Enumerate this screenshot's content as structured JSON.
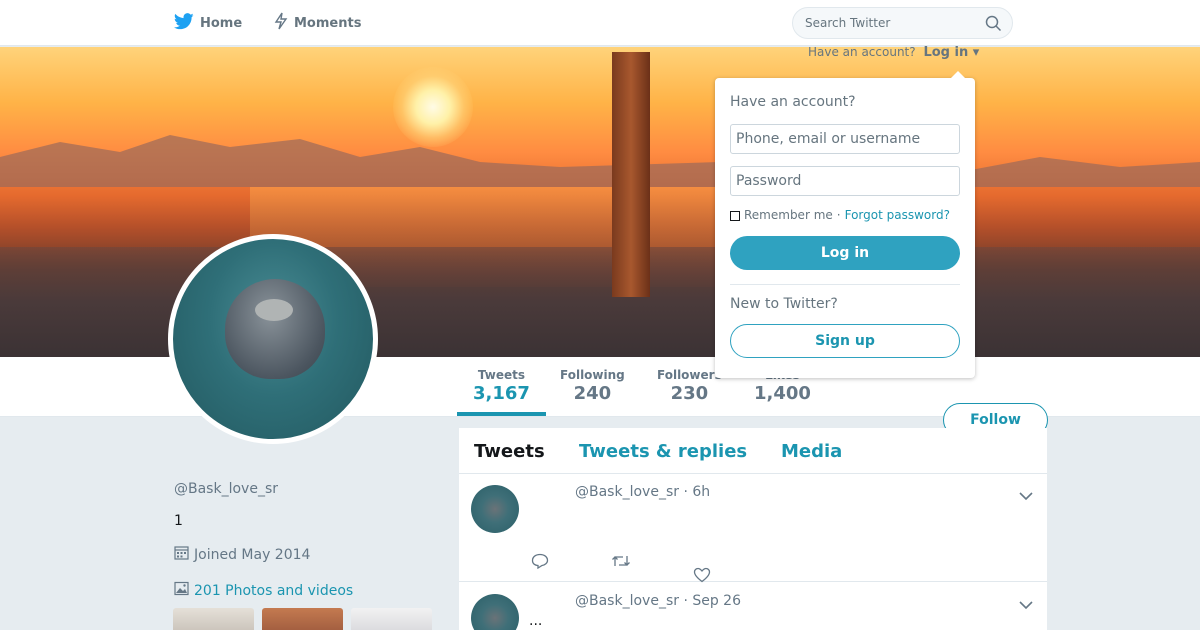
{
  "nav": {
    "home_label": "Home",
    "moments_label": "Moments",
    "search_placeholder": "Search Twitter"
  },
  "login_prompt": {
    "text": "Have an account?",
    "link": "Log in"
  },
  "login_panel": {
    "title": "Have an account?",
    "username_placeholder": "Phone, email or username",
    "password_placeholder": "Password",
    "remember_label": "Remember me",
    "separator": "·",
    "forgot_label": "Forgot password?",
    "login_button": "Log in",
    "new_label": "New to Twitter?",
    "signup_button": "Sign up"
  },
  "stats": [
    {
      "label": "Tweets",
      "value": "3,167"
    },
    {
      "label": "Following",
      "value": "240"
    },
    {
      "label": "Followers",
      "value": "230"
    },
    {
      "label": "Likes",
      "value": "1,400"
    }
  ],
  "follow_button": "Follow",
  "profile": {
    "name": "",
    "handle": "@Bask_love_sr",
    "bio": "1",
    "joined": "Joined May 2014",
    "photos_link": "201 Photos and videos"
  },
  "timeline": {
    "tabs": [
      "Tweets",
      "Tweets & replies",
      "Media"
    ],
    "tweets": [
      {
        "meta": "@Bask_love_sr · 6h",
        "text": ""
      },
      {
        "meta": "@Bask_love_sr · Sep 26",
        "text": "..."
      }
    ]
  },
  "colors": {
    "accent": "#1b95b0",
    "twitter_blue": "#1da1f2",
    "background": "#e6ecf0"
  },
  "icons": {
    "logo": "twitter-bird-icon",
    "moments": "lightning-icon",
    "search": "search-icon",
    "calendar": "calendar-icon",
    "photo": "photo-icon",
    "chevron": "chevron-down-icon",
    "reply": "reply-icon",
    "retweet": "retweet-icon",
    "like": "heart-icon"
  }
}
